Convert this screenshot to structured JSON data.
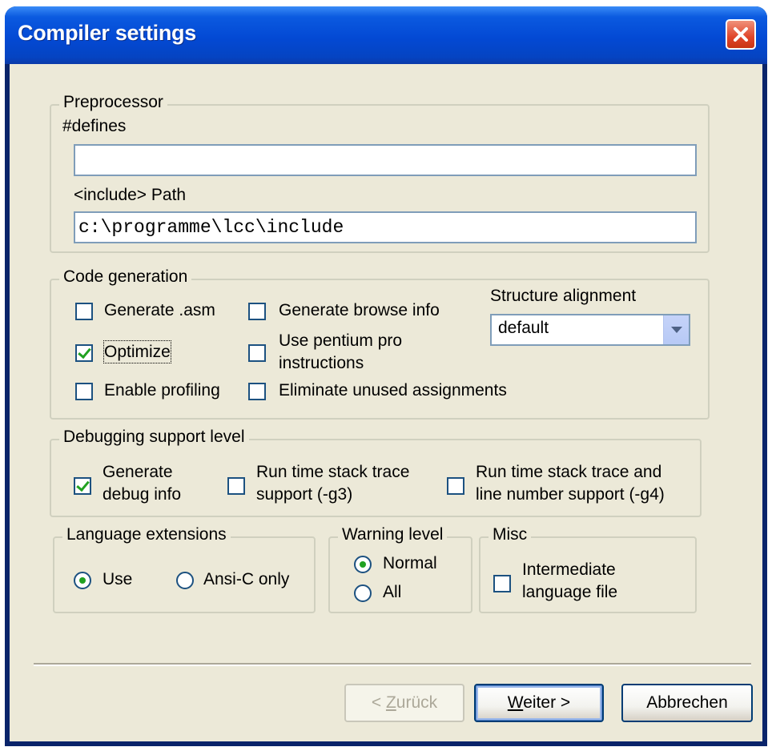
{
  "window": {
    "title": "Compiler settings"
  },
  "preprocessor": {
    "legend": "Preprocessor",
    "defines_label": "#defines",
    "defines_value": "",
    "include_label": "<include> Path",
    "include_value": "c:\\programme\\lcc\\include"
  },
  "code_generation": {
    "legend": "Code generation",
    "generate_asm": {
      "label": "Generate .asm",
      "checked": false
    },
    "generate_browse": {
      "label": "Generate browse info",
      "checked": false
    },
    "optimize": {
      "label": "Optimize",
      "checked": true
    },
    "pentium_pro": {
      "label_line1": "Use pentium pro",
      "label_line2": "instructions",
      "checked": false
    },
    "profiling": {
      "label": "Enable profiling",
      "checked": false
    },
    "eliminate": {
      "label": "Eliminate unused assignments",
      "checked": false
    },
    "alignment_label": "Structure alignment",
    "alignment_value": "default"
  },
  "debugging": {
    "legend": "Debugging support level",
    "debug_info": {
      "label_line1": "Generate",
      "label_line2": "debug info",
      "checked": true
    },
    "stack_trace": {
      "label_line1": "Run time stack trace",
      "label_line2": "support (-g3)",
      "checked": false
    },
    "line_numbers": {
      "label_line1": "Run time stack trace and",
      "label_line2": "line number support (-g4)",
      "checked": false
    }
  },
  "language_extensions": {
    "legend": "Language extensions",
    "use_label": "Use",
    "ansi_label": "Ansi-C only",
    "selected": "Use"
  },
  "warning_level": {
    "legend": "Warning level",
    "normal_label": "Normal",
    "all_label": "All",
    "selected": "Normal"
  },
  "misc": {
    "legend": "Misc",
    "intermediate": {
      "label_line1": "Intermediate",
      "label_line2": "language file",
      "checked": false
    }
  },
  "buttons": {
    "back": {
      "prefix": "< ",
      "mnemonic": "Z",
      "rest": "urück",
      "enabled": false
    },
    "next": {
      "mnemonic": "W",
      "rest": "eiter >"
    },
    "cancel": "Abbrechen"
  },
  "colors": {
    "titlebar": "#0549d4",
    "dialog_bg": "#ece9d8",
    "check_mark": "#21a121",
    "close_button": "#e0452a"
  }
}
